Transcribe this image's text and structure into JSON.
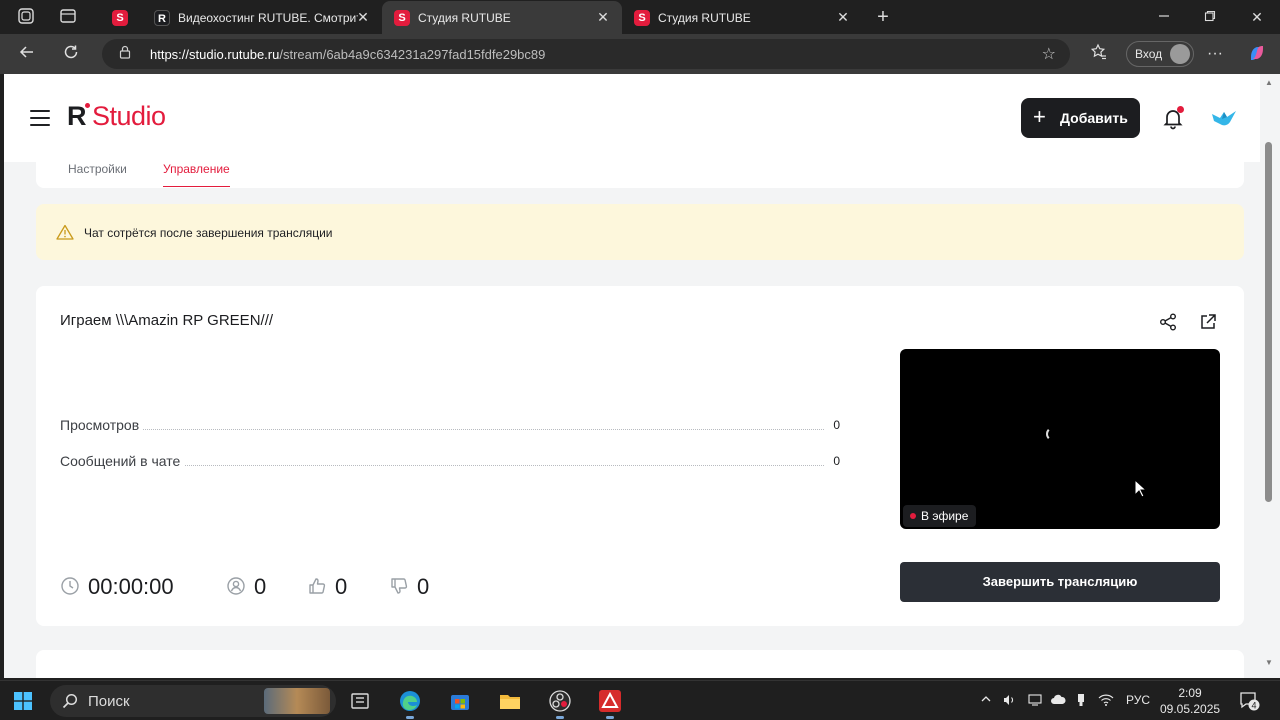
{
  "browser": {
    "tabs": [
      {
        "title": "Видеохостинг RUTUBE. Смотрит",
        "favicon": "R",
        "active": false
      },
      {
        "title": "Студия RUTUBE",
        "favicon": "S",
        "active": true
      },
      {
        "title": "Студия RUTUBE",
        "favicon": "S",
        "active": false
      }
    ],
    "url_host": "https://studio.rutube.ru",
    "url_path": "/stream/6ab4a9c634231a297fad15fdfe29bc89",
    "login_label": "Вход"
  },
  "header": {
    "logo_r": "R",
    "logo_studio": "Studio",
    "add_label": "Добавить"
  },
  "tabs": {
    "settings": "Настройки",
    "manage": "Управление"
  },
  "warning": {
    "text": "Чат сотрётся после завершения трансляции"
  },
  "stream": {
    "title": "Играем \\\\\\Amazin RP GREEN///",
    "stats": [
      {
        "label": "Просмотров",
        "value": "0"
      },
      {
        "label": "Сообщений в чате",
        "value": "0"
      }
    ],
    "live_label": "В эфире",
    "end_label": "Завершить трансляцию",
    "counters": {
      "duration": "00:00:00",
      "viewers": "0",
      "likes": "0",
      "dislikes": "0"
    }
  },
  "taskbar": {
    "search_label": "Поиск",
    "lang": "РУС",
    "time": "2:09",
    "date": "09.05.2025",
    "notifications": "4"
  },
  "colors": {
    "brand_red": "#e31c3d",
    "dark": "#1c1d20",
    "warning_bg": "#fdf7dc",
    "support": "#2b8fb2"
  }
}
